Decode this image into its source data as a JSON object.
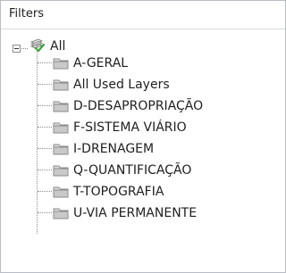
{
  "panel": {
    "title": "Filters"
  },
  "tree": {
    "root": {
      "label": "All",
      "expanded": true,
      "icon": "filter-check-icon"
    },
    "children": [
      {
        "label": "A-GERAL",
        "icon": "folder-icon"
      },
      {
        "label": "All Used Layers",
        "icon": "folder-icon"
      },
      {
        "label": "D-DESAPROPRIAÇÃO",
        "icon": "folder-icon"
      },
      {
        "label": "F-SISTEMA VIÁRIO",
        "icon": "folder-icon"
      },
      {
        "label": "I-DRENAGEM",
        "icon": "folder-icon"
      },
      {
        "label": "Q-QUANTIFICAÇÃO",
        "icon": "folder-icon"
      },
      {
        "label": "T-TOPOGRAFIA",
        "icon": "folder-icon"
      },
      {
        "label": "U-VIA PERMANENTE",
        "icon": "folder-icon"
      }
    ]
  }
}
